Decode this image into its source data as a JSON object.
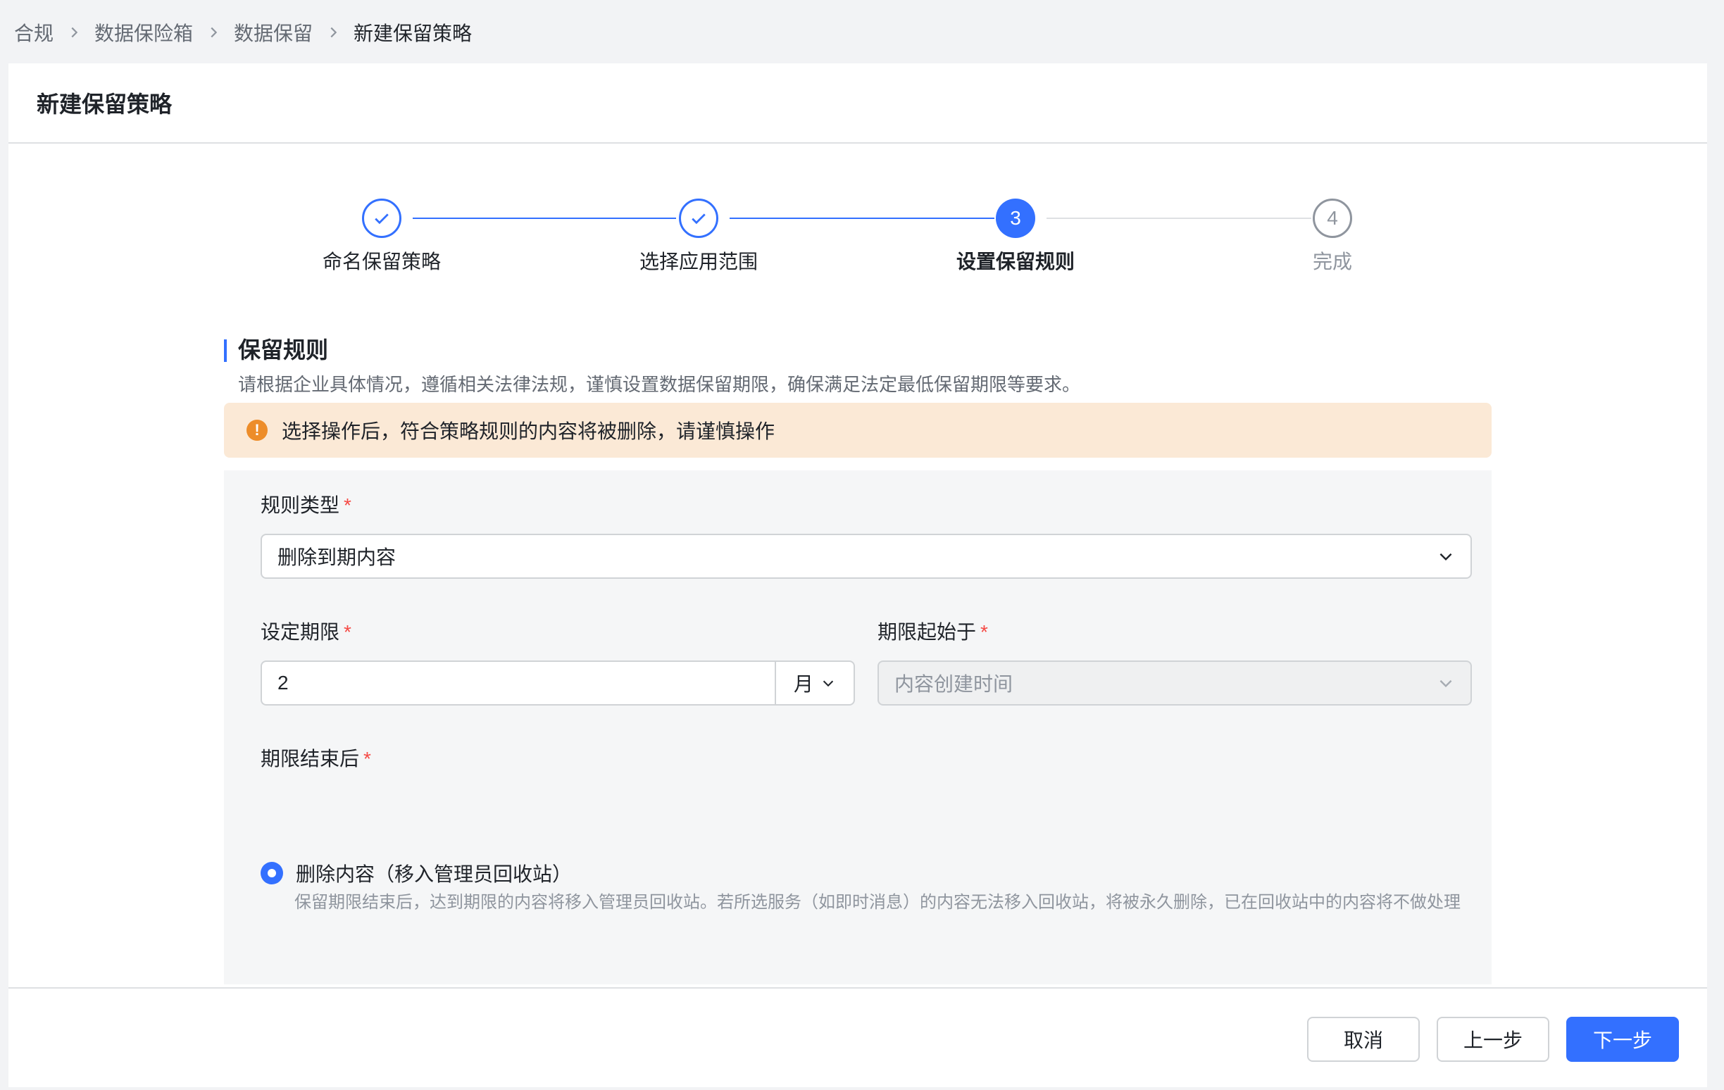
{
  "breadcrumb": {
    "items": [
      "合规",
      "数据保险箱",
      "数据保留"
    ],
    "current": "新建保留策略"
  },
  "page_title": "新建保留策略",
  "steps": [
    {
      "label": "命名保留策略",
      "status": "done"
    },
    {
      "label": "选择应用范围",
      "status": "done"
    },
    {
      "label": "设置保留规则",
      "status": "active",
      "number": "3"
    },
    {
      "label": "完成",
      "status": "todo",
      "number": "4"
    }
  ],
  "section": {
    "title": "保留规则",
    "description": "请根据企业具体情况，遵循相关法律法规，谨慎设置数据保留期限，确保满足法定最低保留期限等要求。"
  },
  "alert": {
    "icon": "warning-icon",
    "icon_glyph": "!",
    "text": "选择操作后，符合策略规则的内容将被删除，请谨慎操作",
    "color": "#ed8d2a",
    "background": "#fbe9d6"
  },
  "form": {
    "rule_type": {
      "label": "规则类型",
      "required_mark": "*",
      "value": "删除到期内容"
    },
    "period": {
      "label": "设定期限",
      "required_mark": "*",
      "value": "2",
      "unit": "月"
    },
    "start_from": {
      "label": "期限起始于",
      "required_mark": "*",
      "placeholder": "内容创建时间",
      "disabled": true
    },
    "after_expiry": {
      "label": "期限结束后",
      "required_mark": "*",
      "option_label": "删除内容（移入管理员回收站）",
      "option_hint": "保留期限结束后，达到期限的内容将移入管理员回收站。若所选服务（如即时消息）的内容无法移入回收站，将被永久删除，已在回收站中的内容将不做处理",
      "selected": true
    }
  },
  "buttons": {
    "cancel": "取消",
    "prev": "上一步",
    "next": "下一步"
  },
  "colors": {
    "primary": "#3370ff",
    "required": "#f54a45",
    "muted": "#8f959e"
  }
}
